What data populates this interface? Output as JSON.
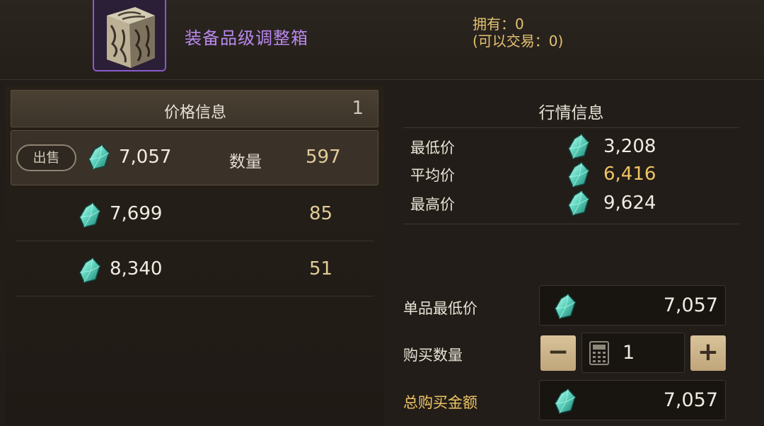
{
  "item": {
    "name": "装备品级调整箱",
    "owned": "拥有：0",
    "tradable": "(可以交易：0)"
  },
  "price_info": {
    "title": "价格信息",
    "page": "1",
    "listings": [
      {
        "badge": "出售",
        "price": "7,057",
        "qty_label": "数量",
        "qty": "597"
      },
      {
        "price": "7,699",
        "qty": "85"
      },
      {
        "price": "8,340",
        "qty": "51"
      }
    ]
  },
  "market": {
    "title": "行情信息",
    "lowest_label": "最低价",
    "lowest": "3,208",
    "average_label": "平均价",
    "average": "6,416",
    "highest_label": "最高价",
    "highest": "9,624"
  },
  "purchase": {
    "unit_price_label": "单品最低价",
    "unit_price": "7,057",
    "quantity_label": "购买数量",
    "quantity": "1",
    "minus": "−",
    "plus": "+",
    "total_label": "总购买金额",
    "total": "7,057"
  },
  "colors": {
    "item_name": "#b889ee",
    "owned": "#e2c271",
    "average": "#f0c464",
    "stepper": "#cfb588"
  },
  "icons": {
    "currency": "gem-icon",
    "quantity_input": "calculator-icon"
  }
}
